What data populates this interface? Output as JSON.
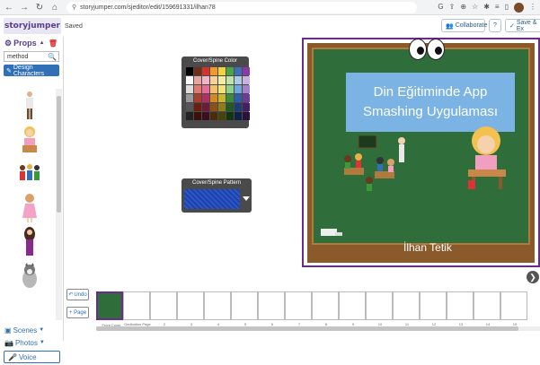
{
  "browser": {
    "url": "storyjumper.com/sjeditor/edit/159691331/ilhan78",
    "nav_icons": [
      "back-icon",
      "forward-icon",
      "reload-icon",
      "home-icon"
    ]
  },
  "app": {
    "logo": "storyjumper",
    "saved_status": "Saved",
    "collaborate_label": "Collaborate",
    "help_label": "?",
    "save_label": "Save & Ex"
  },
  "sidebar": {
    "props_title": "Props",
    "search_value": "method",
    "design_characters_label": "Design Characters",
    "props": [
      "businessman",
      "girl-reading",
      "kids-group",
      "girl-pink-dress",
      "woman-long-hair",
      "husky-dog"
    ],
    "scenes_label": "Scenes",
    "photos_label": "Photos",
    "voice_label": "Voice"
  },
  "cover_color_panel": {
    "title": "Cover/Spine Color",
    "colors": [
      "#000000",
      "#6b2f1a",
      "#d4332a",
      "#f09a2e",
      "#f3d33a",
      "#4aa54a",
      "#3e6fb8",
      "#8a3aa0",
      "#ffffff",
      "#e9a6a0",
      "#f3b4c9",
      "#f6d29a",
      "#f3eea1",
      "#bfe3a8",
      "#a9cbe8",
      "#c9b3dc",
      "#dddddd",
      "#e07a6e",
      "#e86a98",
      "#f0c06a",
      "#f1e37a",
      "#8fd08b",
      "#6fa8de",
      "#a582c8",
      "#999999",
      "#a8402e",
      "#b03066",
      "#d18a26",
      "#cbb72a",
      "#3c8a3c",
      "#2f5ea8",
      "#6e3c92",
      "#555555",
      "#6a1e12",
      "#6e1a3a",
      "#8a5218",
      "#8c7e1a",
      "#235a23",
      "#1e3c78",
      "#45205e",
      "#222222",
      "#3a100a",
      "#3d0d20",
      "#4a2b0c",
      "#4a420c",
      "#123512",
      "#0f2148",
      "#2a1238"
    ]
  },
  "cover_pattern_panel": {
    "title": "Cover/Spine Pattern"
  },
  "cover": {
    "title_line1": "Din Eğitiminde App",
    "title_line2": "Smashing Uygulaması",
    "author": "İlhan Tetik"
  },
  "filmstrip": {
    "undo_label": "Undo",
    "add_page_label": "+ Page",
    "pages": [
      "Front Cover",
      "Dedication Page",
      "2",
      "3",
      "4",
      "5",
      "6",
      "7",
      "8",
      "9",
      "10",
      "11",
      "12",
      "13",
      "14",
      "15"
    ]
  }
}
